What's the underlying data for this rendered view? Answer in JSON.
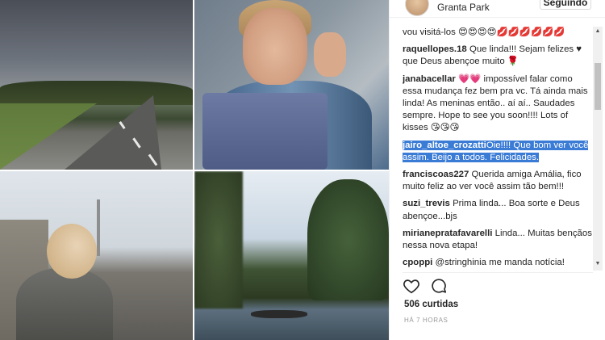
{
  "header": {
    "location": "Granta Park",
    "follow_label": "Seguindo"
  },
  "comments": [
    {
      "user": "",
      "text": "vou visitá-los 😍😍😍😍💋💋💋💋💋💋"
    },
    {
      "user": "raquellopes.18",
      "text": "Que linda!!! Sejam felizes ♥ que Deus abençoe muito 🌹"
    },
    {
      "user": "janabacellar",
      "text": "💗💗 impossível falar como essa mudança fez bem pra vc. Tá ainda mais linda! As meninas então.. aí aí.. Saudades sempre. Hope to see you soon!!!! Lots of kisses 😘😘😘"
    },
    {
      "user": "jairo_altoe_crozatti",
      "text": "Oie!!!! Que bom ver você assim. Beijo a todos. Felicidades.",
      "selected": true
    },
    {
      "user": "franciscoas227",
      "text": "Querida amiga Amália, fico muito feliz ao ver você assim tão bem!!!"
    },
    {
      "user": "suzi_trevis",
      "text": "Prima linda... Boa sorte e Deus abençoe...bjs"
    },
    {
      "user": "mirianepratafavarelli",
      "text": "Linda... Muitas bençãos nessa nova etapa!"
    },
    {
      "user": "cpoppi",
      "text": "@stringhinia me manda notícia! Saudades beijos e que seiam ainda mais"
    }
  ],
  "likes": "506 curtidas",
  "timestamp": "HÁ 7 HORAS",
  "icons": {
    "like": "heart-icon",
    "comment": "comment-bubble-icon"
  }
}
